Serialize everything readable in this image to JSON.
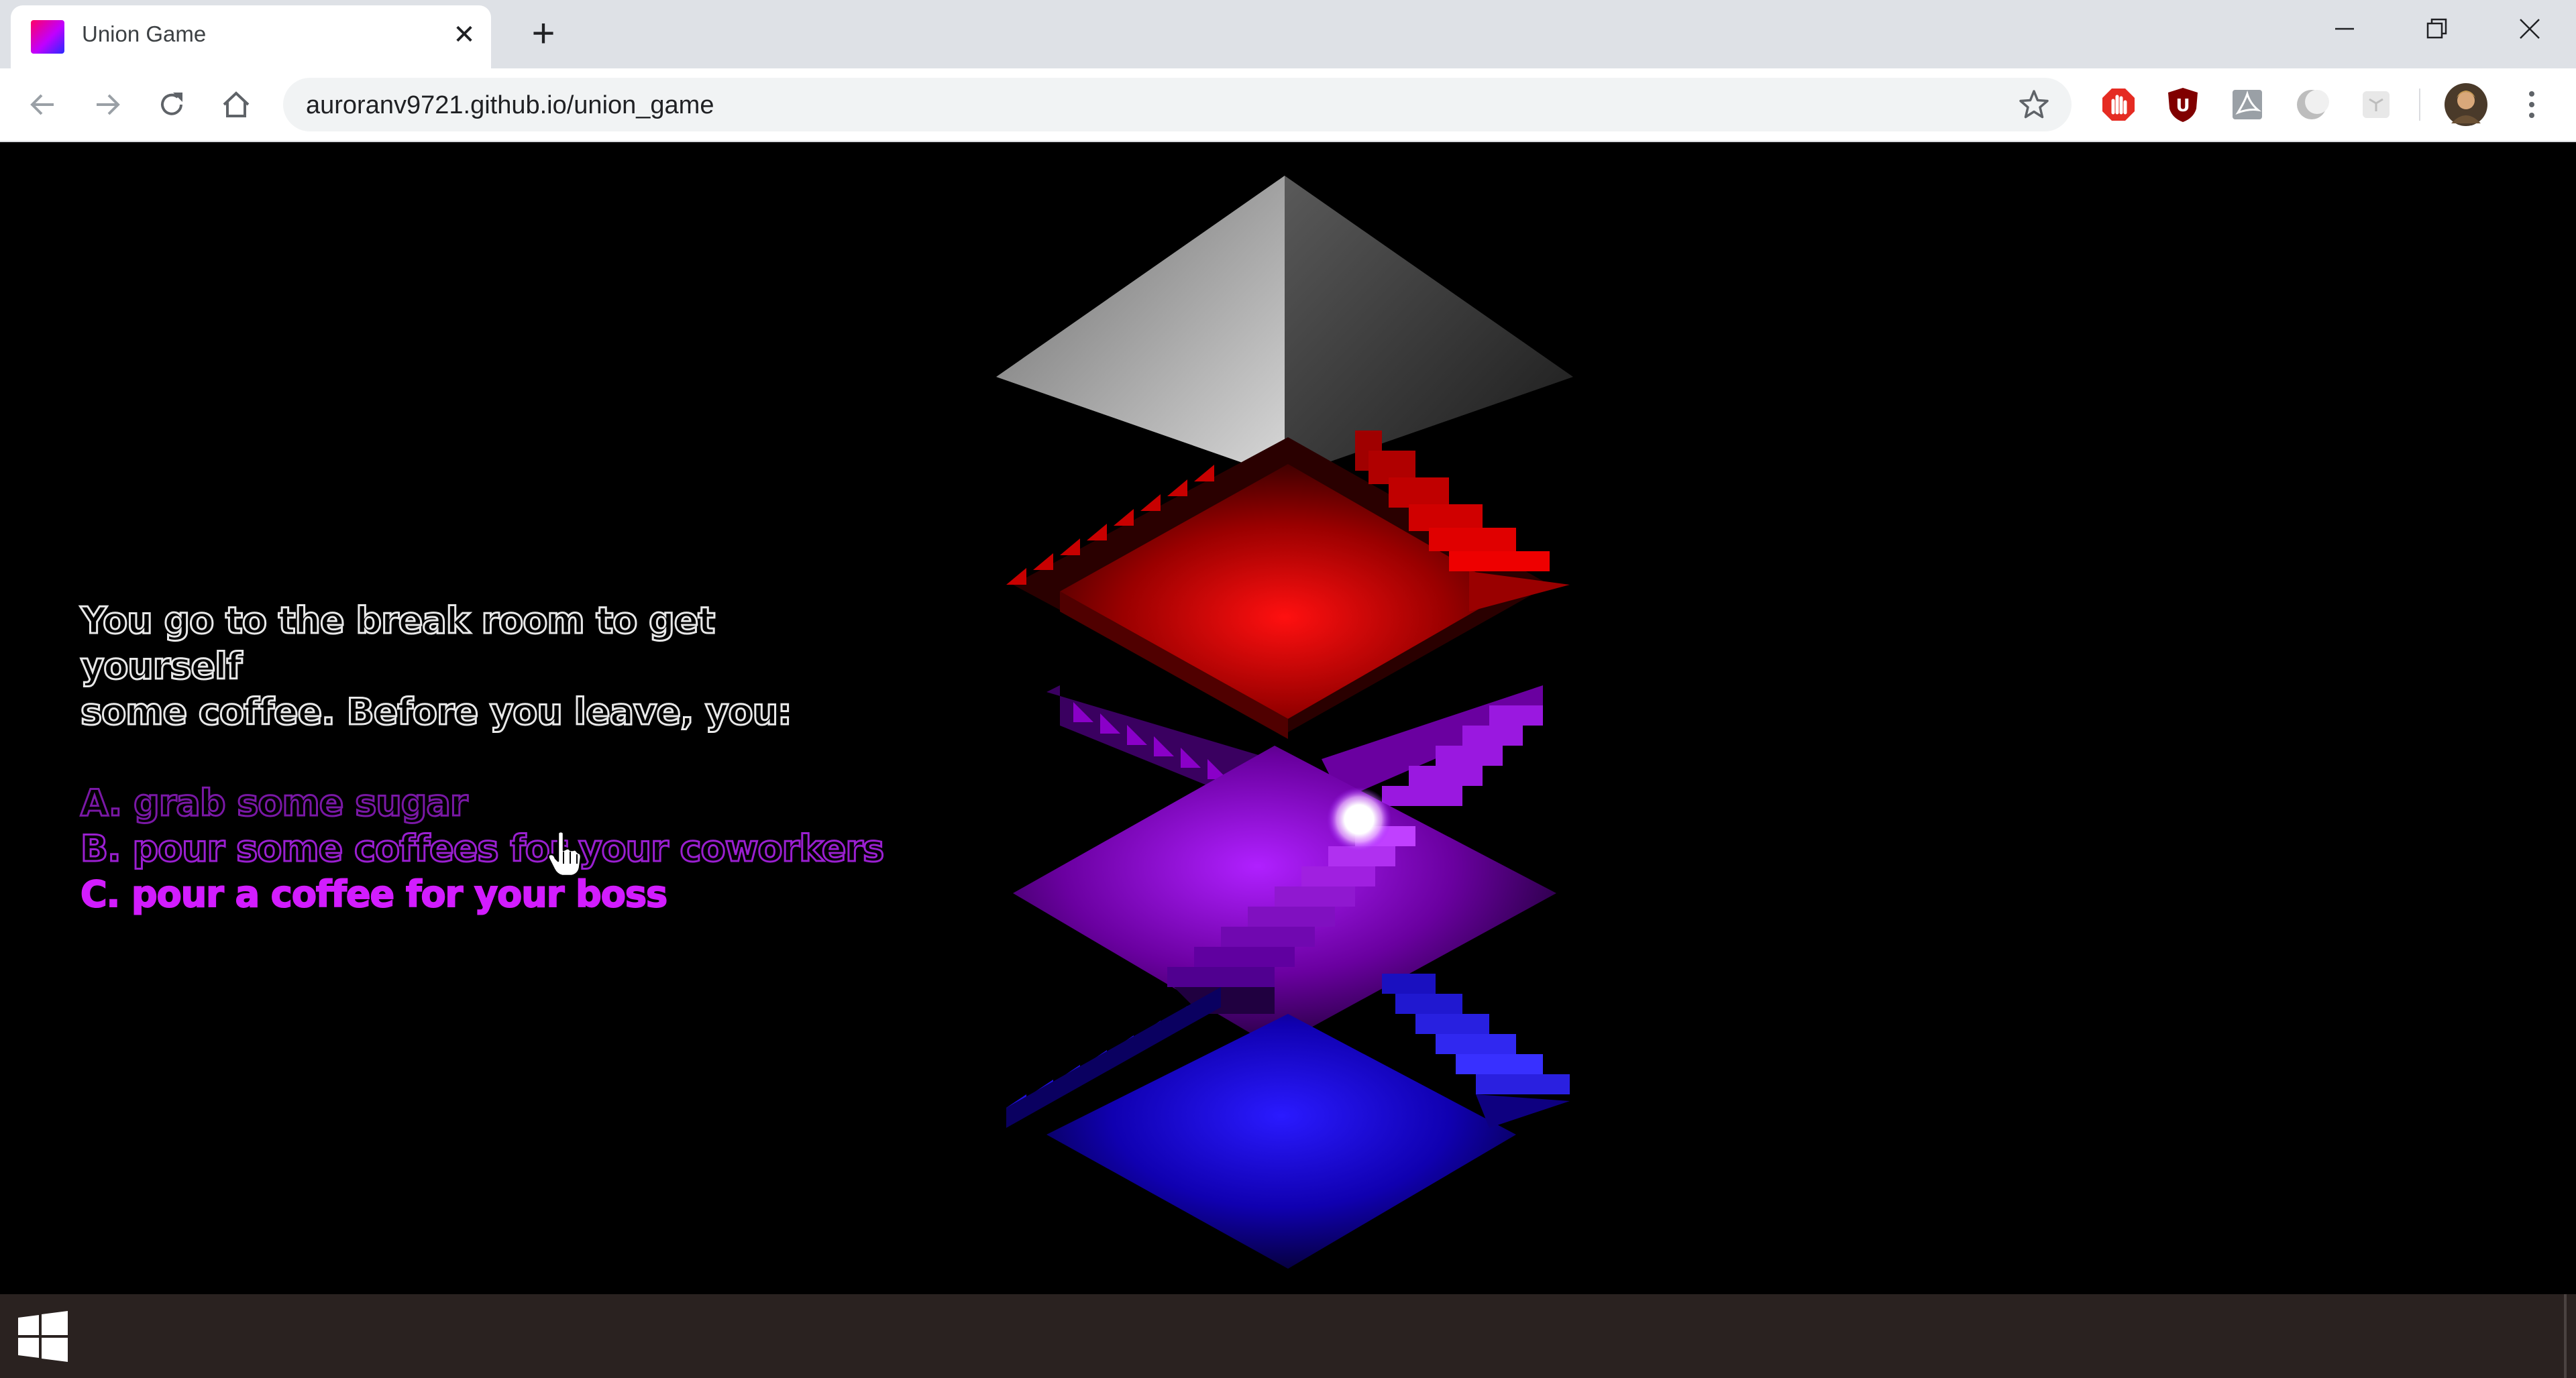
{
  "browser": {
    "tab_title": "Union Game",
    "url": "auroranv9721.github.io/union_game",
    "extensions": [
      "adblock-icon",
      "ublock-icon",
      "pdf-icon",
      "moon-icon",
      "cube-icon"
    ]
  },
  "game": {
    "prompt_line1": "You go to the break room to get yourself",
    "prompt_line2": "some coffee. Before you leave, you:",
    "choices": [
      "A. grab some sugar",
      "B. pour some coffees for your coworkers",
      "C. pour a coffee for your boss"
    ],
    "highlighted_choice": 2,
    "colors": {
      "background": "#000000",
      "text_outline": "#e8e8e8",
      "choice_dim": "#7a18a6",
      "choice_highlight": "#d21cff",
      "level_red": "#cc0000",
      "level_purple": "#8a00c8",
      "level_blue": "#1a00e0",
      "pyramid": "#9a9a9a"
    }
  },
  "taskbar": {
    "start_icon": "windows-logo-icon"
  }
}
